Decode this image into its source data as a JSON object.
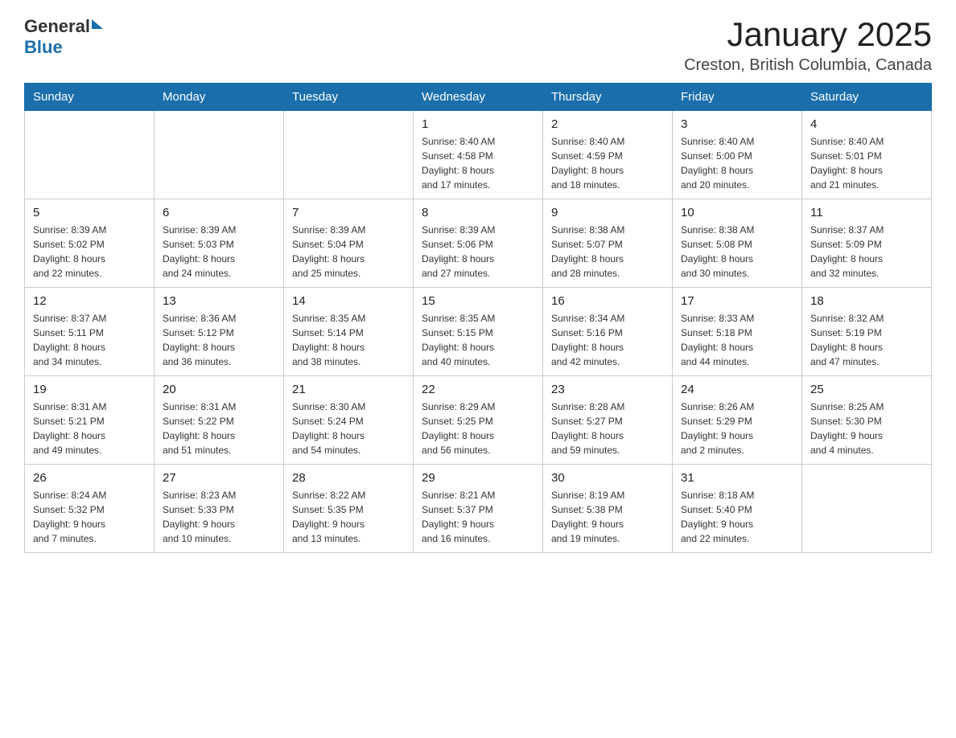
{
  "logo": {
    "general": "General",
    "blue": "Blue"
  },
  "header": {
    "month": "January 2025",
    "location": "Creston, British Columbia, Canada"
  },
  "days_of_week": [
    "Sunday",
    "Monday",
    "Tuesday",
    "Wednesday",
    "Thursday",
    "Friday",
    "Saturday"
  ],
  "weeks": [
    [
      {
        "day": "",
        "info": ""
      },
      {
        "day": "",
        "info": ""
      },
      {
        "day": "",
        "info": ""
      },
      {
        "day": "1",
        "info": "Sunrise: 8:40 AM\nSunset: 4:58 PM\nDaylight: 8 hours\nand 17 minutes."
      },
      {
        "day": "2",
        "info": "Sunrise: 8:40 AM\nSunset: 4:59 PM\nDaylight: 8 hours\nand 18 minutes."
      },
      {
        "day": "3",
        "info": "Sunrise: 8:40 AM\nSunset: 5:00 PM\nDaylight: 8 hours\nand 20 minutes."
      },
      {
        "day": "4",
        "info": "Sunrise: 8:40 AM\nSunset: 5:01 PM\nDaylight: 8 hours\nand 21 minutes."
      }
    ],
    [
      {
        "day": "5",
        "info": "Sunrise: 8:39 AM\nSunset: 5:02 PM\nDaylight: 8 hours\nand 22 minutes."
      },
      {
        "day": "6",
        "info": "Sunrise: 8:39 AM\nSunset: 5:03 PM\nDaylight: 8 hours\nand 24 minutes."
      },
      {
        "day": "7",
        "info": "Sunrise: 8:39 AM\nSunset: 5:04 PM\nDaylight: 8 hours\nand 25 minutes."
      },
      {
        "day": "8",
        "info": "Sunrise: 8:39 AM\nSunset: 5:06 PM\nDaylight: 8 hours\nand 27 minutes."
      },
      {
        "day": "9",
        "info": "Sunrise: 8:38 AM\nSunset: 5:07 PM\nDaylight: 8 hours\nand 28 minutes."
      },
      {
        "day": "10",
        "info": "Sunrise: 8:38 AM\nSunset: 5:08 PM\nDaylight: 8 hours\nand 30 minutes."
      },
      {
        "day": "11",
        "info": "Sunrise: 8:37 AM\nSunset: 5:09 PM\nDaylight: 8 hours\nand 32 minutes."
      }
    ],
    [
      {
        "day": "12",
        "info": "Sunrise: 8:37 AM\nSunset: 5:11 PM\nDaylight: 8 hours\nand 34 minutes."
      },
      {
        "day": "13",
        "info": "Sunrise: 8:36 AM\nSunset: 5:12 PM\nDaylight: 8 hours\nand 36 minutes."
      },
      {
        "day": "14",
        "info": "Sunrise: 8:35 AM\nSunset: 5:14 PM\nDaylight: 8 hours\nand 38 minutes."
      },
      {
        "day": "15",
        "info": "Sunrise: 8:35 AM\nSunset: 5:15 PM\nDaylight: 8 hours\nand 40 minutes."
      },
      {
        "day": "16",
        "info": "Sunrise: 8:34 AM\nSunset: 5:16 PM\nDaylight: 8 hours\nand 42 minutes."
      },
      {
        "day": "17",
        "info": "Sunrise: 8:33 AM\nSunset: 5:18 PM\nDaylight: 8 hours\nand 44 minutes."
      },
      {
        "day": "18",
        "info": "Sunrise: 8:32 AM\nSunset: 5:19 PM\nDaylight: 8 hours\nand 47 minutes."
      }
    ],
    [
      {
        "day": "19",
        "info": "Sunrise: 8:31 AM\nSunset: 5:21 PM\nDaylight: 8 hours\nand 49 minutes."
      },
      {
        "day": "20",
        "info": "Sunrise: 8:31 AM\nSunset: 5:22 PM\nDaylight: 8 hours\nand 51 minutes."
      },
      {
        "day": "21",
        "info": "Sunrise: 8:30 AM\nSunset: 5:24 PM\nDaylight: 8 hours\nand 54 minutes."
      },
      {
        "day": "22",
        "info": "Sunrise: 8:29 AM\nSunset: 5:25 PM\nDaylight: 8 hours\nand 56 minutes."
      },
      {
        "day": "23",
        "info": "Sunrise: 8:28 AM\nSunset: 5:27 PM\nDaylight: 8 hours\nand 59 minutes."
      },
      {
        "day": "24",
        "info": "Sunrise: 8:26 AM\nSunset: 5:29 PM\nDaylight: 9 hours\nand 2 minutes."
      },
      {
        "day": "25",
        "info": "Sunrise: 8:25 AM\nSunset: 5:30 PM\nDaylight: 9 hours\nand 4 minutes."
      }
    ],
    [
      {
        "day": "26",
        "info": "Sunrise: 8:24 AM\nSunset: 5:32 PM\nDaylight: 9 hours\nand 7 minutes."
      },
      {
        "day": "27",
        "info": "Sunrise: 8:23 AM\nSunset: 5:33 PM\nDaylight: 9 hours\nand 10 minutes."
      },
      {
        "day": "28",
        "info": "Sunrise: 8:22 AM\nSunset: 5:35 PM\nDaylight: 9 hours\nand 13 minutes."
      },
      {
        "day": "29",
        "info": "Sunrise: 8:21 AM\nSunset: 5:37 PM\nDaylight: 9 hours\nand 16 minutes."
      },
      {
        "day": "30",
        "info": "Sunrise: 8:19 AM\nSunset: 5:38 PM\nDaylight: 9 hours\nand 19 minutes."
      },
      {
        "day": "31",
        "info": "Sunrise: 8:18 AM\nSunset: 5:40 PM\nDaylight: 9 hours\nand 22 minutes."
      },
      {
        "day": "",
        "info": ""
      }
    ]
  ]
}
